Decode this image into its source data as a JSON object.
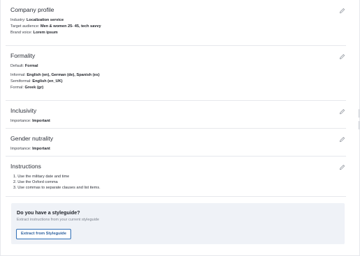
{
  "company_profile": {
    "title": "Company profile",
    "rows": [
      {
        "label": "Industry:",
        "value": "Localization service"
      },
      {
        "label": "Target audience:",
        "value": "Men & women 25- 45, tech savvy"
      },
      {
        "label": "Brand voice:",
        "value": "Lorem ipsum"
      }
    ]
  },
  "formality": {
    "title": "Formality",
    "default": {
      "label": "Default:",
      "value": "Formal"
    },
    "rows": [
      {
        "label": "Informal:",
        "value": "English (en), German (de), Spanish (es)"
      },
      {
        "label": "Semiformal:",
        "value": "English (en_UK)"
      },
      {
        "label": "Formal:",
        "value": "Greek (gr)"
      }
    ]
  },
  "inclusivity": {
    "title": "Inclusivity",
    "rows": [
      {
        "label": "Importance:",
        "value": "Important"
      }
    ]
  },
  "gender_neutrality": {
    "title": "Gender nutrality",
    "rows": [
      {
        "label": "Importance:",
        "value": "Important"
      }
    ]
  },
  "instructions": {
    "title": "Instructions",
    "items": [
      "1. Use the military date and time",
      "2. Use the Oxford comma",
      "3. Use commas to separate clauses and list items."
    ]
  },
  "styleguide_callout": {
    "title": "Do you have a styleguide?",
    "subtitle": "Extract instructions from your current styleguide",
    "button_label": "Extract from Styleguide"
  },
  "icons": {
    "edit": "pencil-edit-icon"
  },
  "colors": {
    "callout_bg": "#eff2f7",
    "button_border": "#2f6fb6",
    "button_text": "#2a5f9e",
    "divider": "#e6e8ec"
  }
}
